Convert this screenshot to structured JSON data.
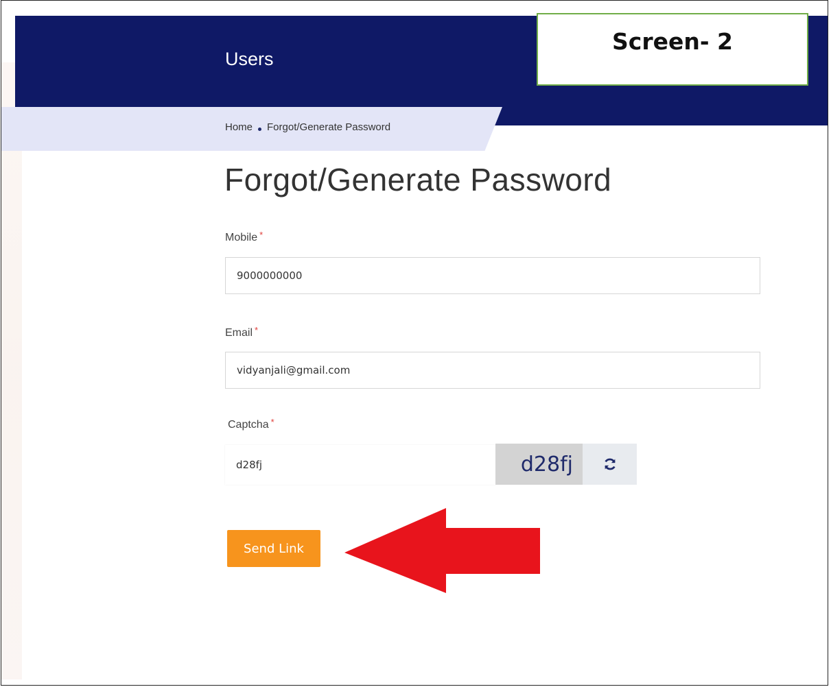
{
  "header": {
    "title": "Users"
  },
  "annotation": {
    "screen_label": "Screen- 2"
  },
  "breadcrumb": {
    "home": "Home",
    "current": "Forgot/Generate Password"
  },
  "page": {
    "title": "Forgot/Generate Password"
  },
  "form": {
    "mobile": {
      "label": "Mobile",
      "required": "*",
      "value": "9000000000"
    },
    "email": {
      "label": "Email",
      "required": "*",
      "value": "vidyanjali@gmail.com"
    },
    "captcha": {
      "label": "Captcha",
      "required": "*",
      "value": "d28fj",
      "image_text": "d28fj"
    },
    "submit_label": "Send Link"
  },
  "icons": {
    "refresh": "refresh-icon",
    "annotation_arrow": "left-arrow-icon"
  },
  "colors": {
    "header_bg": "#0f1966",
    "breadcrumb_bg": "#e3e5f7",
    "button_bg": "#f7941d",
    "arrow": "#e8141c",
    "label_border": "#70ad47",
    "required": "#e0403c"
  }
}
